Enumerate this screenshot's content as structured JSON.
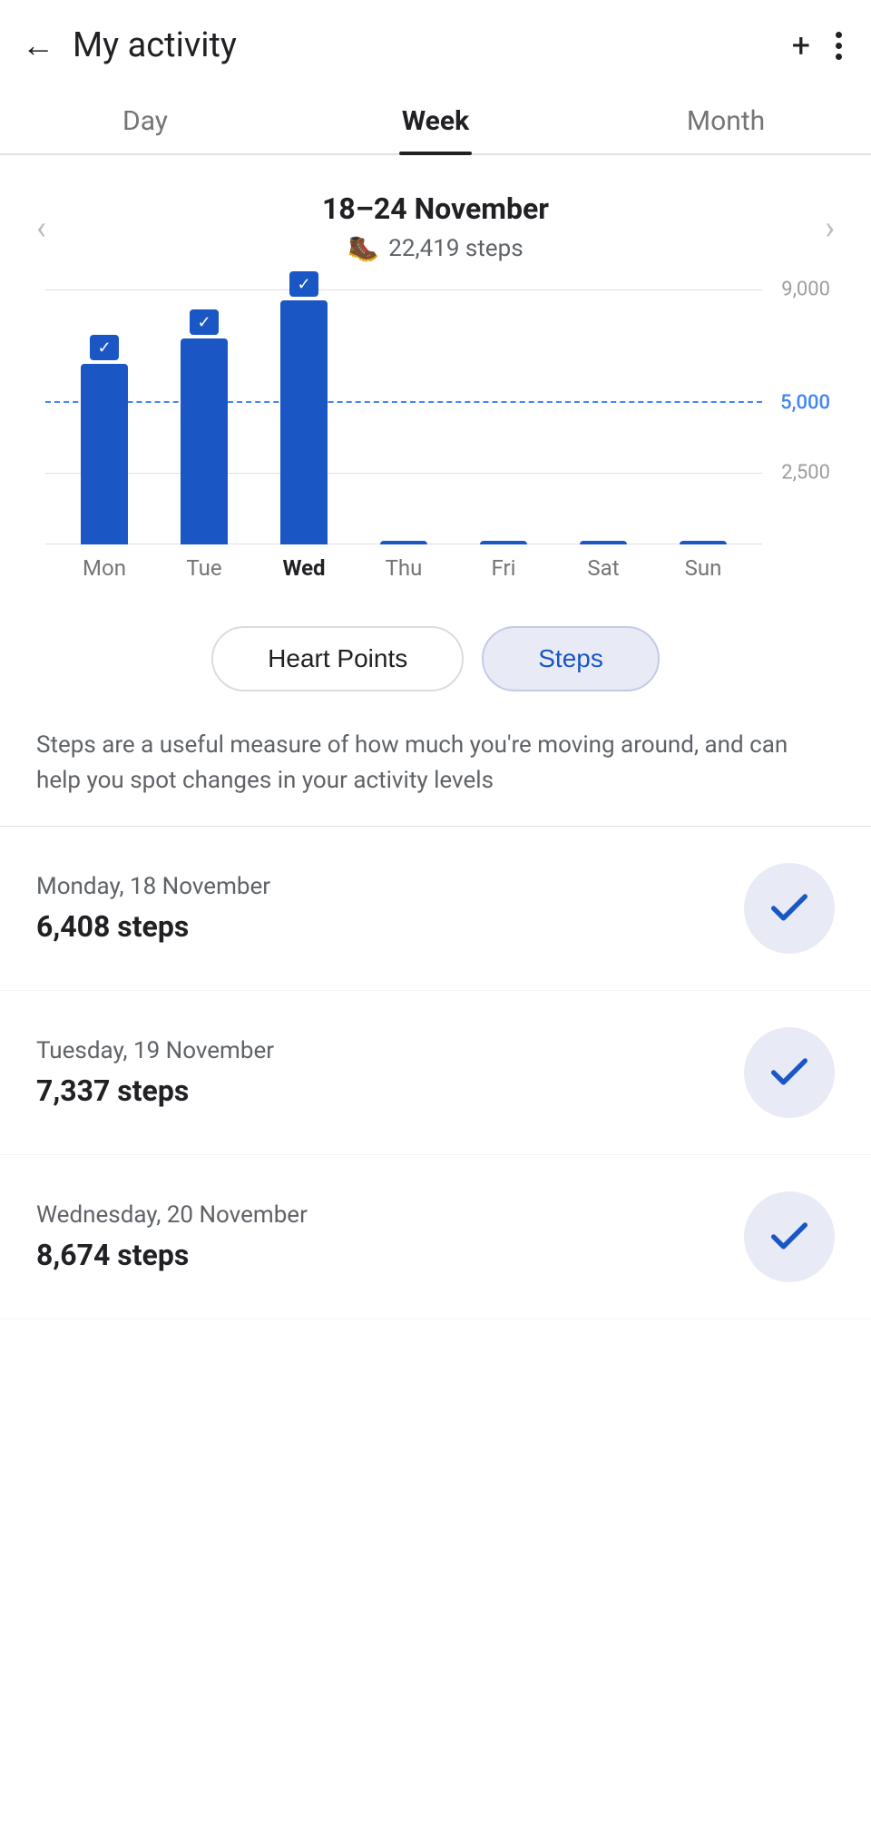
{
  "header": {
    "title": "My activity",
    "back_label": "←",
    "plus_label": "+",
    "dots_label": "⋮"
  },
  "tabs": [
    {
      "id": "day",
      "label": "Day",
      "active": false
    },
    {
      "id": "week",
      "label": "Week",
      "active": true
    },
    {
      "id": "month",
      "label": "Month",
      "active": false
    }
  ],
  "week_nav": {
    "date_range": "18–24 November",
    "total_steps": "22,419 steps",
    "prev_label": "‹",
    "next_label": "›"
  },
  "chart": {
    "y_labels": [
      {
        "value": "9,000",
        "pct": 100
      },
      {
        "value": "5,000",
        "pct": 55.6,
        "dashed": true,
        "blue": true
      },
      {
        "value": "2,500",
        "pct": 27.8
      }
    ],
    "days": [
      {
        "label": "Mon",
        "steps": 6408,
        "pct": 71,
        "has_check": true,
        "active": false
      },
      {
        "label": "Tue",
        "steps": 7337,
        "pct": 81,
        "has_check": true,
        "active": false
      },
      {
        "label": "Wed",
        "steps": 8674,
        "pct": 96,
        "has_check": true,
        "active": true
      },
      {
        "label": "Thu",
        "steps": 0,
        "pct": 0,
        "has_check": false,
        "active": false
      },
      {
        "label": "Fri",
        "steps": 0,
        "pct": 0,
        "has_check": false,
        "active": false
      },
      {
        "label": "Sat",
        "steps": 0,
        "pct": 0,
        "has_check": false,
        "active": false
      },
      {
        "label": "Sun",
        "steps": 0,
        "pct": 0,
        "has_check": false,
        "active": false
      }
    ]
  },
  "toggles": [
    {
      "id": "heart_points",
      "label": "Heart Points",
      "active": false
    },
    {
      "id": "steps",
      "label": "Steps",
      "active": true
    }
  ],
  "description": "Steps are a useful measure of how much you're moving around, and can help you spot changes in your activity levels",
  "daily_entries": [
    {
      "date": "Monday, 18 November",
      "steps": "6,408 steps",
      "goal_met": true
    },
    {
      "date": "Tuesday, 19 November",
      "steps": "7,337 steps",
      "goal_met": true
    },
    {
      "date": "Wednesday, 20 November",
      "steps": "8,674 steps",
      "goal_met": true
    }
  ]
}
